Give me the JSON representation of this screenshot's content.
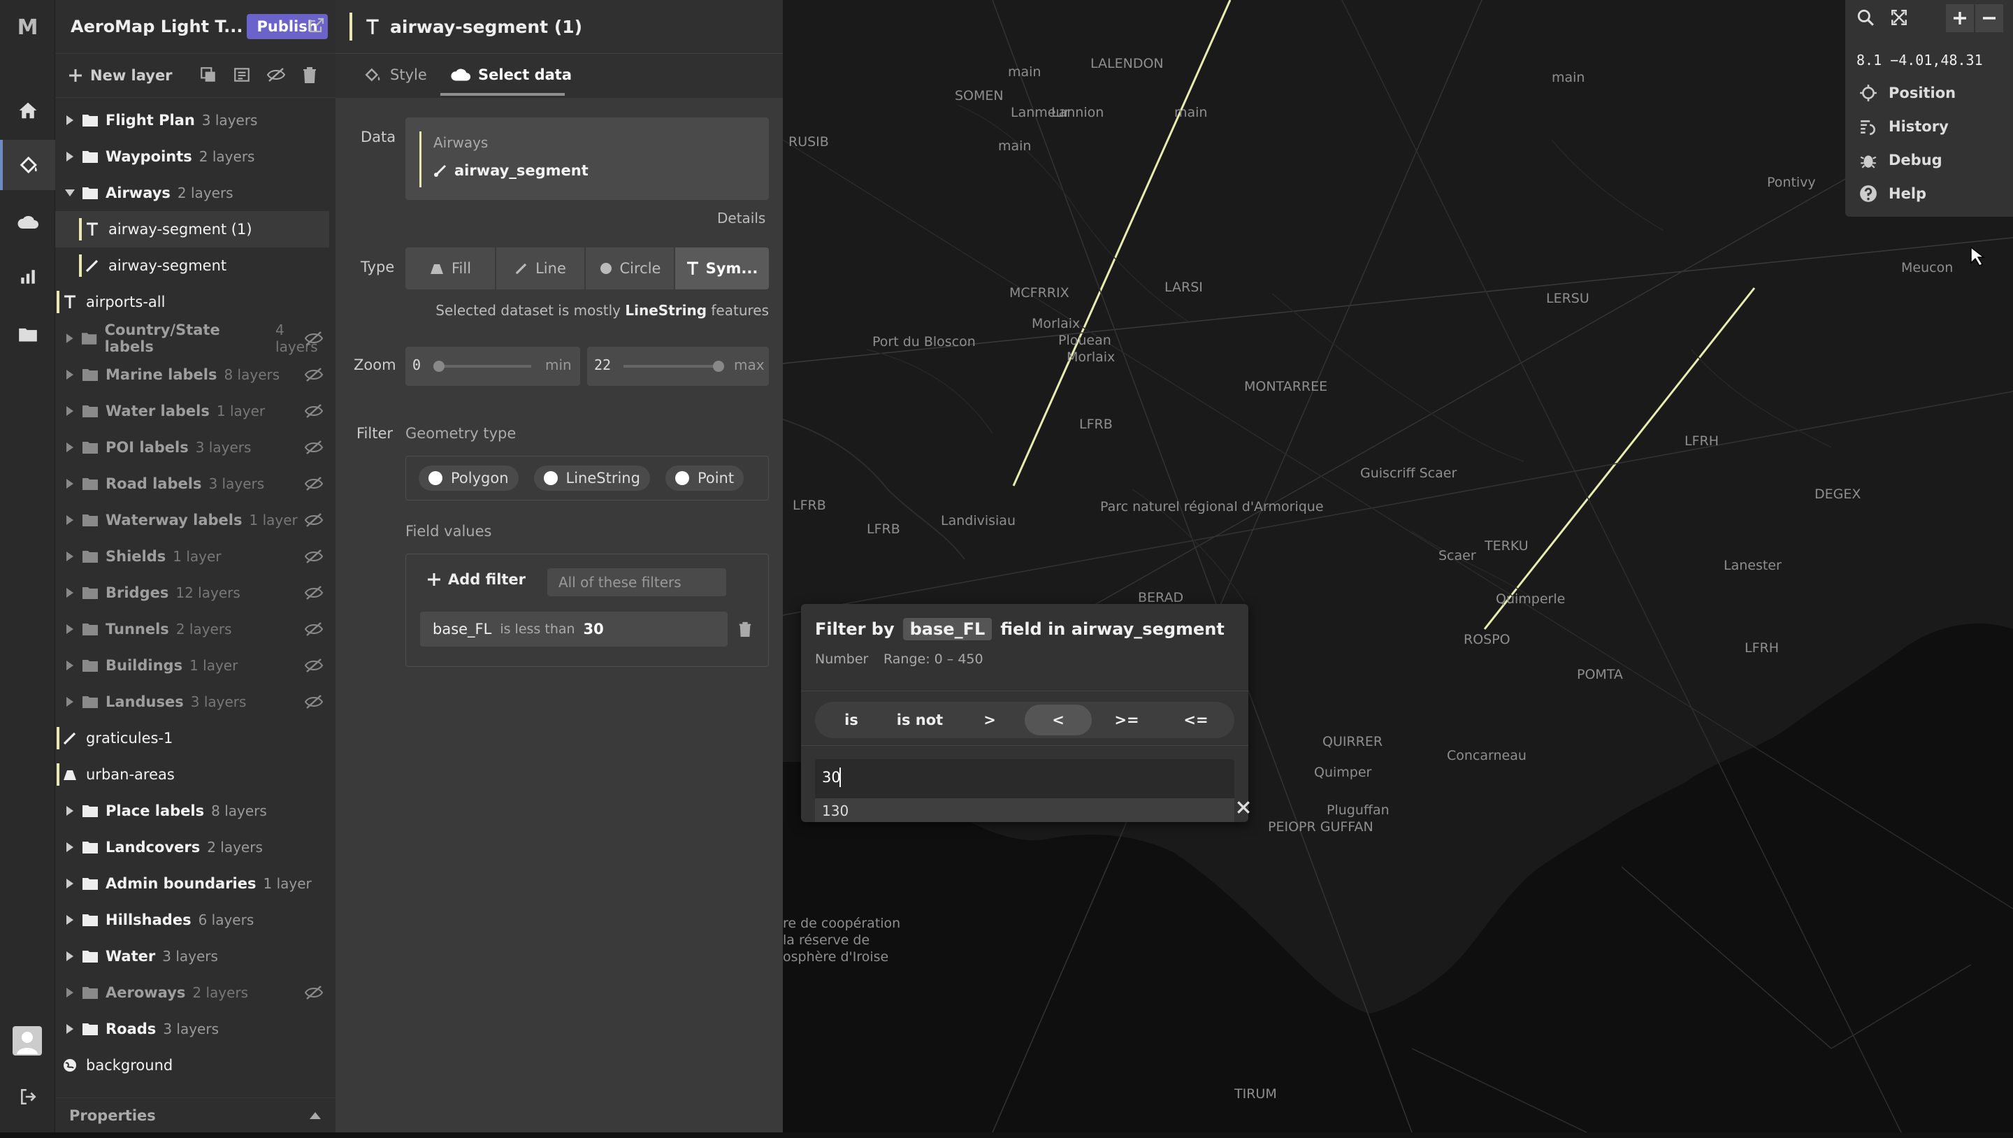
{
  "app": {
    "logo": "M",
    "project_title": "AeroMap Light T...",
    "publish_label": "Publish"
  },
  "rail": {
    "icons": [
      "home-icon",
      "paint-icon",
      "cloud-icon",
      "chart-icon",
      "folder-icon"
    ]
  },
  "layers_panel": {
    "new_layer_label": "New layer",
    "properties_label": "Properties",
    "items": [
      {
        "name": "Flight Plan",
        "count": "3 layers",
        "kind": "group"
      },
      {
        "name": "Waypoints",
        "count": "2 layers",
        "kind": "group"
      },
      {
        "name": "Airways",
        "count": "2 layers",
        "kind": "group-open"
      },
      {
        "name": "airway-segment (1)",
        "kind": "symbol",
        "selected": true
      },
      {
        "name": "airway-segment",
        "kind": "line"
      },
      {
        "name": "airports-all",
        "kind": "symbol"
      },
      {
        "name": "Country/State labels",
        "count": "4 layers",
        "kind": "group-hidden"
      },
      {
        "name": "Marine labels",
        "count": "8 layers",
        "kind": "group-hidden"
      },
      {
        "name": "Water labels",
        "count": "1 layer",
        "kind": "group-hidden"
      },
      {
        "name": "POI labels",
        "count": "3 layers",
        "kind": "group-hidden"
      },
      {
        "name": "Road labels",
        "count": "3 layers",
        "kind": "group-hidden"
      },
      {
        "name": "Waterway labels",
        "count": "1 layer",
        "kind": "group-hidden"
      },
      {
        "name": "Shields",
        "count": "1 layer",
        "kind": "group-hidden"
      },
      {
        "name": "Bridges",
        "count": "12 layers",
        "kind": "group-hidden"
      },
      {
        "name": "Tunnels",
        "count": "2 layers",
        "kind": "group-hidden"
      },
      {
        "name": "Buildings",
        "count": "1 layer",
        "kind": "group-hidden"
      },
      {
        "name": "Landuses",
        "count": "3 layers",
        "kind": "group-hidden"
      },
      {
        "name": "graticules-1",
        "kind": "line"
      },
      {
        "name": "urban-areas",
        "kind": "fill"
      },
      {
        "name": "Place labels",
        "count": "8 layers",
        "kind": "group"
      },
      {
        "name": "Landcovers",
        "count": "2 layers",
        "kind": "group"
      },
      {
        "name": "Admin boundaries",
        "count": "1 layer",
        "kind": "group"
      },
      {
        "name": "Hillshades",
        "count": "6 layers",
        "kind": "group"
      },
      {
        "name": "Water",
        "count": "3 layers",
        "kind": "group"
      },
      {
        "name": "Aeroways",
        "count": "2 layers",
        "kind": "group-hidden"
      },
      {
        "name": "Roads",
        "count": "3 layers",
        "kind": "group"
      },
      {
        "name": "background",
        "kind": "background"
      }
    ]
  },
  "editor": {
    "layer_title": "airway-segment (1)",
    "tab_style": "Style",
    "tab_select": "Select data",
    "data_label": "Data",
    "data_source": "Airways",
    "data_layer": "airway_segment",
    "details_label": "Details",
    "type_label": "Type",
    "types": [
      "Fill",
      "Line",
      "Circle",
      "Sym..."
    ],
    "selected_type": "Sym...",
    "dataset_note_prefix": "Selected dataset is mostly ",
    "dataset_note_strong": "LineString",
    "dataset_note_suffix": " features",
    "zoom_label": "Zoom",
    "zoom_min_value": "0",
    "zoom_min_label": "min",
    "zoom_max_value": "22",
    "zoom_max_label": "max",
    "filter_label": "Filter",
    "geometry_label": "Geometry type",
    "geometry_options": [
      "Polygon",
      "LineString",
      "Point"
    ],
    "field_values_label": "Field values",
    "add_filter_label": "Add filter",
    "match_placeholder": "All of these filters",
    "filter_field": "base_FL",
    "filter_op": "is less than",
    "filter_value": "30"
  },
  "popup": {
    "title_prefix": "Filter by",
    "field": "base_FL",
    "title_suffix": "field in airway_segment",
    "field_type": "Number",
    "range": "Range: 0 – 450",
    "operators": [
      "is",
      "is not",
      ">",
      "<",
      ">=",
      "<="
    ],
    "selected_operator": "<",
    "input_value": "30",
    "suggestion": "130"
  },
  "map_controls": {
    "coords": "8.1 −4.01,48.31",
    "items": [
      "Position",
      "History",
      "Debug",
      "Help"
    ]
  },
  "map_labels": [
    "main",
    "LALENDON",
    "SOMEN",
    "RUSIB",
    "main",
    "main",
    "MCFRRIX",
    "LARSI",
    "Port du Bloscon",
    "Plouean",
    "Morlaix",
    "MONTARREE",
    "Guiscriff Scaer",
    "LERSU",
    "LFRH",
    "DEGEX",
    "Parc naturel régional d'Armorique",
    "Landivisiau",
    "Quimperle",
    "ROSPO",
    "POMTA",
    "QUIRRER",
    "Concarneau",
    "Quimper",
    "Pluguffan",
    "PEIOPR GUFFAN",
    "TIRUM",
    "Meucon",
    "Pontivy",
    "Scaer",
    "TERKU",
    "Lanester",
    "BERAD",
    "LFRB",
    "LFRH",
    "re de coopération",
    "la réserve de",
    "osphère d'Iroise",
    "Morlaix",
    "LFRB",
    "main",
    "Lanmeur",
    "Lannion",
    "LFRB"
  ]
}
